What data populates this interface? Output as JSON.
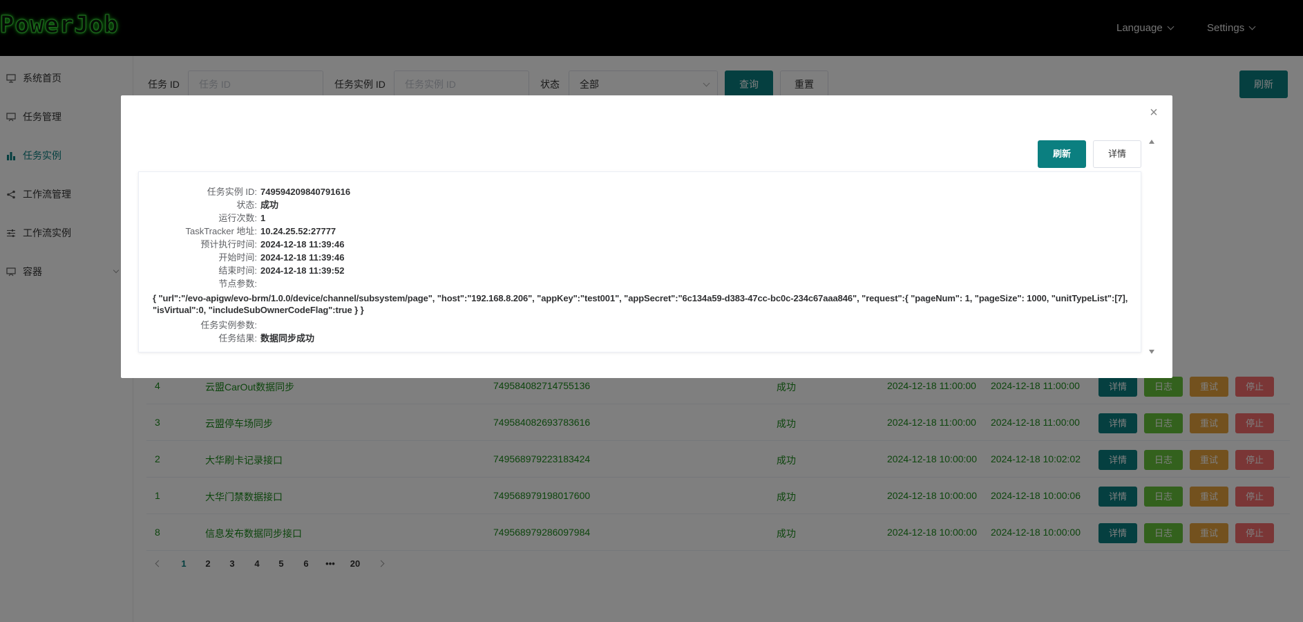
{
  "header": {
    "logo": "PowerJob",
    "language_label": "Language",
    "settings_label": "Settings"
  },
  "sidebar": {
    "items": [
      {
        "label": "系统首页",
        "icon": "monitor-icon"
      },
      {
        "label": "任务管理",
        "icon": "presentation-icon"
      },
      {
        "label": "任务实例",
        "icon": "bar-chart-icon",
        "active": true
      },
      {
        "label": "工作流管理",
        "icon": "share-icon"
      },
      {
        "label": "工作流实例",
        "icon": "sliders-icon"
      },
      {
        "label": "容器",
        "icon": "presentation-icon"
      }
    ]
  },
  "filters": {
    "task_id_label": "任务 ID",
    "task_id_placeholder": "任务 ID",
    "instance_id_label": "任务实例 ID",
    "instance_id_placeholder": "任务实例 ID",
    "status_label": "状态",
    "status_value": "全部",
    "query_button": "查询",
    "reset_button": "重置",
    "refresh_button": "刷新"
  },
  "table": {
    "op_labels": {
      "detail": "详情",
      "log": "日志",
      "retry": "重试",
      "stop": "停止"
    },
    "rows": [
      {
        "task_id": "4",
        "name": "云盟CarOut数据同步",
        "instance_id": "749584082714755136",
        "status": "成功",
        "expected": "2024-12-18 11:00:00",
        "finished": "2024-12-18 11:00:00"
      },
      {
        "task_id": "3",
        "name": "云盟停车场同步",
        "instance_id": "749584082693783616",
        "status": "成功",
        "expected": "2024-12-18 11:00:00",
        "finished": "2024-12-18 11:00:00"
      },
      {
        "task_id": "2",
        "name": "大华刷卡记录接口",
        "instance_id": "749568979223183424",
        "status": "成功",
        "expected": "2024-12-18 10:00:00",
        "finished": "2024-12-18 10:02:02"
      },
      {
        "task_id": "1",
        "name": "大华门禁数据接口",
        "instance_id": "749568979198017600",
        "status": "成功",
        "expected": "2024-12-18 10:00:00",
        "finished": "2024-12-18 10:00:06"
      },
      {
        "task_id": "8",
        "name": "信息发布数据同步接口",
        "instance_id": "749568979286097984",
        "status": "成功",
        "expected": "2024-12-18 10:00:00",
        "finished": "2024-12-18 10:00:00"
      }
    ]
  },
  "pagination": {
    "pages": [
      "1",
      "2",
      "3",
      "4",
      "5",
      "6",
      "•••",
      "20"
    ],
    "current": "1"
  },
  "modal": {
    "refresh_button": "刷新",
    "detail_button": "详情",
    "fields": [
      {
        "key": "任务实例 ID:",
        "value": "749594209840791616"
      },
      {
        "key": "状态:",
        "value": "成功"
      },
      {
        "key": "运行次数:",
        "value": "1"
      },
      {
        "key": "TaskTracker 地址:",
        "value": "10.24.25.52:27777"
      },
      {
        "key": "预计执行时间:",
        "value": "2024-12-18 11:39:46"
      },
      {
        "key": "开始时间:",
        "value": "2024-12-18 11:39:46"
      },
      {
        "key": "结束时间:",
        "value": "2024-12-18 11:39:52"
      },
      {
        "key": "节点参数:",
        "value": ""
      }
    ],
    "node_params": "{ \"url\":\"/evo-apigw/evo-brm/1.0.0/device/channel/subsystem/page\", \"host\":\"192.168.8.206\", \"appKey\":\"test001\", \"appSecret\":\"6c134a59-d383-47cc-bc0c-234c67aaa846\", \"request\":{ \"pageNum\": 1, \"pageSize\": 1000, \"unitTypeList\":[7], \"isVirtual\":0, \"includeSubOwnerCodeFlag\":true } }",
    "instance_params_key": "任务实例参数:",
    "instance_params_value": "",
    "result_key": "任务结果:",
    "result_value": "数据同步成功"
  },
  "colors": {
    "accent": "#0b7f80",
    "log": "#67c23a",
    "retry": "#e6a23c",
    "stop": "#f56c6c",
    "row_text": "#1a8a1a"
  }
}
